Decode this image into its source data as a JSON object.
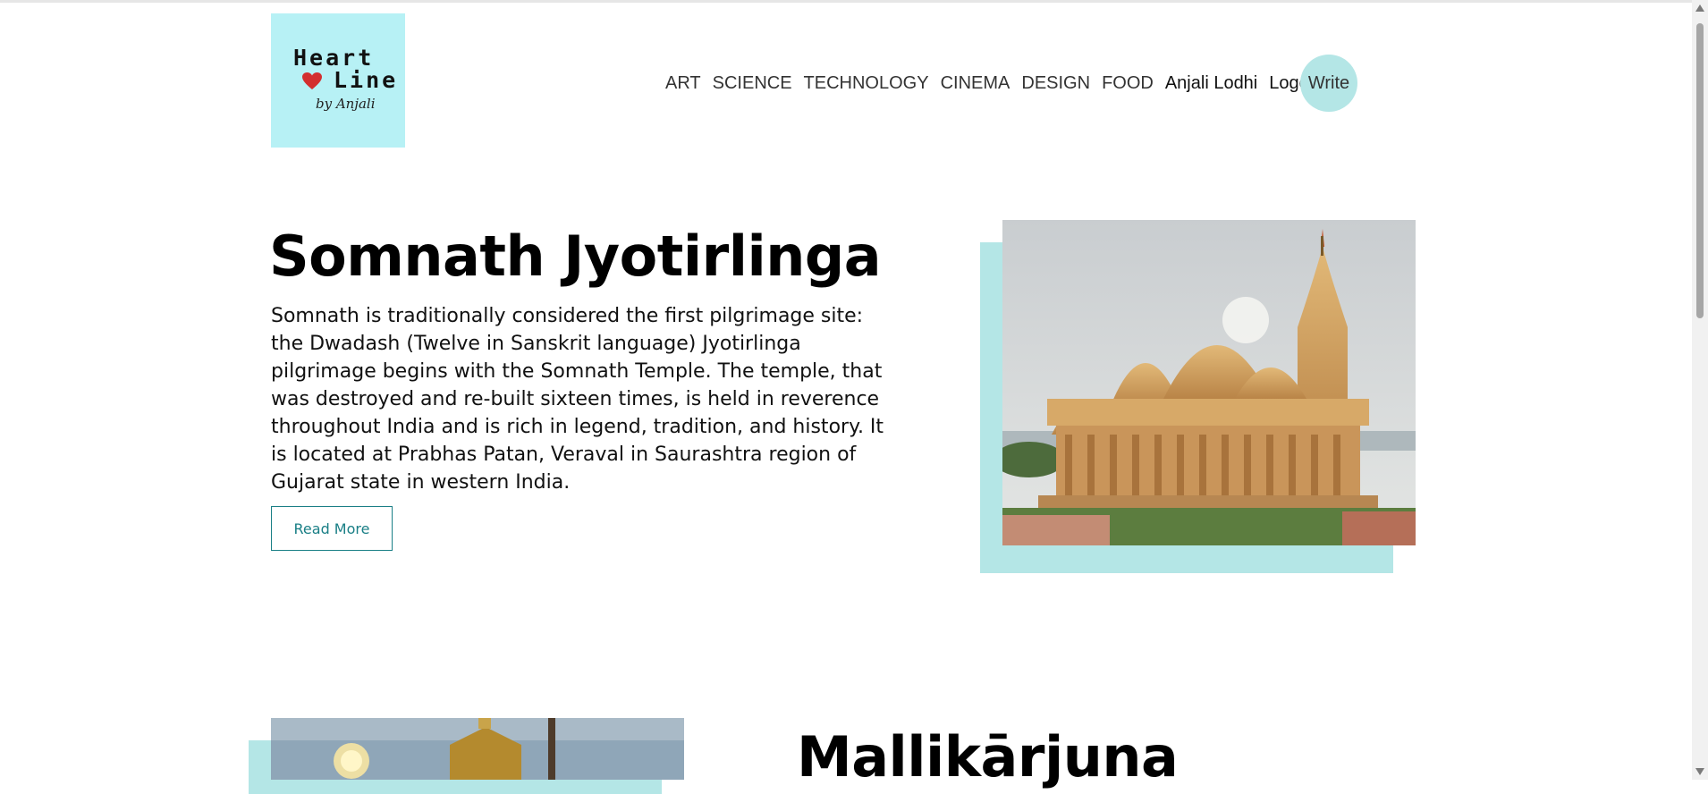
{
  "header": {
    "logo": {
      "word1": "Heart",
      "word2": "Line",
      "signature": "by Anjali"
    },
    "nav": {
      "categories": [
        "ART",
        "SCIENCE",
        "TECHNOLOGY",
        "CINEMA",
        "DESIGN",
        "FOOD"
      ],
      "user_name": "Anjali Lodhi",
      "logout_label": "Logout",
      "write_label": "Write"
    }
  },
  "posts": [
    {
      "title": "Somnath Jyotirlinga",
      "description": "Somnath is traditionally considered the first pilgrimage site: the Dwadash (Twelve in Sanskrit language) Jyotirlinga pilgrimage begins with the Somnath Temple. The temple, that was destroyed and re-built sixteen times, is held in reverence throughout India and is rich in legend, tradition, and history. It is located at Prabhas Patan, Veraval in Saurashtra region of Gujarat state in western India.",
      "read_more_label": "Read More"
    },
    {
      "title": "Mallikārjuna"
    }
  ],
  "colors": {
    "accent": "#b4e6e6",
    "logo_bg": "#b7f1f5",
    "button_text": "#1a7f86",
    "heart": "#d32f2f"
  }
}
